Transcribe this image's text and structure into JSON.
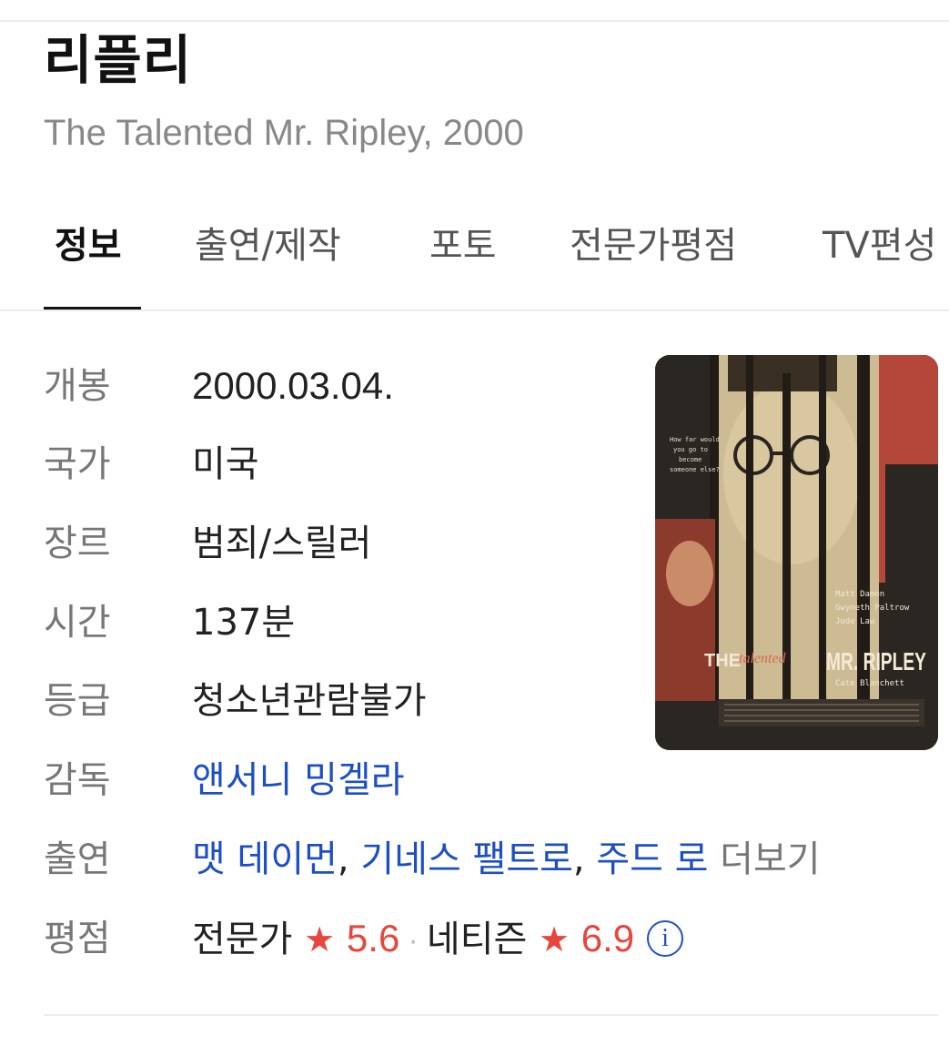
{
  "movie": {
    "title": "리플리",
    "subtitle": "The Talented Mr. Ripley, 2000"
  },
  "tabs": [
    {
      "label": "정보",
      "active": true
    },
    {
      "label": "출연/제작",
      "active": false
    },
    {
      "label": "포토",
      "active": false
    },
    {
      "label": "전문가평점",
      "active": false
    },
    {
      "label": "TV편성",
      "active": false
    }
  ],
  "info": {
    "release": {
      "label": "개봉",
      "value": "2000.03.04."
    },
    "country": {
      "label": "국가",
      "value": "미국"
    },
    "genre": {
      "label": "장르",
      "value": "범죄/스릴러"
    },
    "runtime": {
      "label": "시간",
      "value": "137분"
    },
    "rating": {
      "label": "등급",
      "value": "청소년관람불가"
    },
    "director": {
      "label": "감독",
      "value": "앤서니 밍겔라"
    },
    "cast": {
      "label": "출연",
      "names": [
        "맷 데이먼",
        "기네스 팰트로",
        "주드 로"
      ],
      "separator": ",",
      "more": "더보기"
    },
    "score": {
      "label": "평점",
      "critic_label": "전문가",
      "critic_score": "5.6",
      "netizen_label": "네티즌",
      "netizen_score": "6.9",
      "star": "★",
      "dot": "·",
      "info_icon": "i"
    }
  },
  "poster": {
    "tagline": [
      "How far would",
      "you go to",
      "become",
      "someone else?"
    ],
    "credits": [
      "Matt Damon",
      "Gwyneth Paltrow",
      "Jude Law"
    ],
    "title_the": "THE",
    "title_talented": "talented",
    "title_main": "MR. RIPLEY",
    "extra_credit": "Cate Blanchett"
  },
  "colors": {
    "link": "#1d4fc4",
    "star": "#e8453c",
    "poster_red": "#b5473a"
  }
}
